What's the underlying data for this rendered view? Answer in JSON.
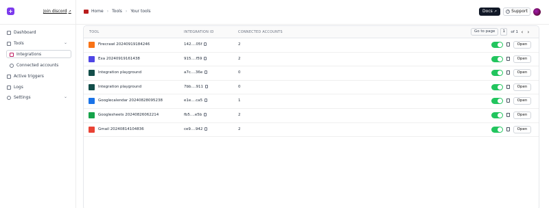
{
  "header": {
    "join_discord": "Join discord",
    "breadcrumb": [
      "Home",
      "Tools",
      "Your tools"
    ],
    "docs_label": "Docs",
    "support_label": "Support"
  },
  "sidebar": {
    "items": [
      {
        "label": "Dashboard",
        "icon": "grid-icon"
      },
      {
        "label": "Tools",
        "icon": "wrench-icon"
      },
      {
        "label": "Integrations",
        "icon": "puzzle-icon",
        "active": true
      },
      {
        "label": "Connected accounts",
        "icon": "users-icon"
      },
      {
        "label": "Active triggers",
        "icon": "bolt-icon"
      },
      {
        "label": "Logs",
        "icon": "file-icon"
      },
      {
        "label": "Settings",
        "icon": "gear-icon"
      }
    ]
  },
  "table": {
    "columns": [
      "TOOL",
      "INTEGRATION ID",
      "CONNECTED ACCOUNTS"
    ],
    "pagination": {
      "goto_label": "Go to page",
      "page": "1",
      "of_label": "of 1"
    },
    "rows": [
      {
        "tool": "Firecrawl 20240919184246",
        "id": "142....05f",
        "accounts": "2",
        "icon_color": "#f97316"
      },
      {
        "tool": "Exa 20240919161438",
        "id": "915....f59",
        "accounts": "2",
        "icon_color": "#4f46e5"
      },
      {
        "tool": "Integration playground",
        "id": "a7c....36e",
        "accounts": "0",
        "icon_color": "#134e4a"
      },
      {
        "tool": "Integration playground",
        "id": "7bb....911",
        "accounts": "0",
        "icon_color": "#134e4a"
      },
      {
        "tool": "Googlecalendar 20240828095238",
        "id": "e1e....ca5",
        "accounts": "1",
        "icon_color": "#1a73e8"
      },
      {
        "tool": "Googlesheets 20240826062214",
        "id": "fb5....e5b",
        "accounts": "2",
        "icon_color": "#16a34a"
      },
      {
        "tool": "Gmail 20240814104836",
        "id": "ce9....942",
        "accounts": "2",
        "icon_color": "#ea4335"
      }
    ],
    "open_label": "Open"
  }
}
